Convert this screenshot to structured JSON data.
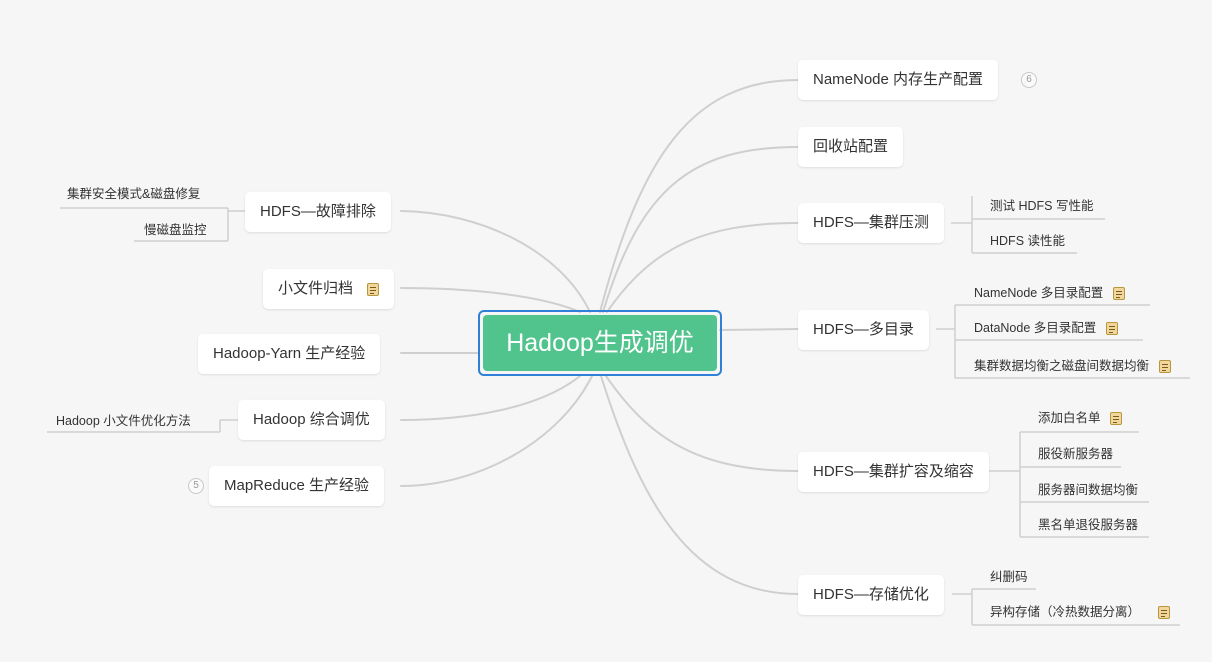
{
  "central": "Hadoop生成调优",
  "right": {
    "namenode_memory": "NameNode 内存生产配置",
    "namenode_memory_badge": "6",
    "recycle": "回收站配置",
    "benchmark": "HDFS—集群压测",
    "benchmark_write": "测试 HDFS 写性能",
    "benchmark_read": "HDFS 读性能",
    "multi_dir": "HDFS—多目录",
    "multi_dir_namenode": "NameNode 多目录配置",
    "multi_dir_datanode": "DataNode 多目录配置",
    "multi_dir_balance": "集群数据均衡之磁盘间数据均衡",
    "scale": "HDFS—集群扩容及缩容",
    "scale_whitelist": "添加白名单",
    "scale_new_server": "服役新服务器",
    "scale_balance": "服务器间数据均衡",
    "scale_blacklist": "黑名单退役服务器",
    "storage": "HDFS—存储优化",
    "storage_ec": "纠删码",
    "storage_hetero": "异构存储（冷热数据分离）"
  },
  "left": {
    "fault": "HDFS—故障排除",
    "fault_safemode": "集群安全模式&磁盘修复",
    "fault_slowdisk": "慢磁盘监控",
    "small_file": "小文件归档",
    "yarn": "Hadoop-Yarn 生产经验",
    "tuning": "Hadoop 综合调优",
    "tuning_smallfile": "Hadoop 小文件优化方法",
    "mapreduce": "MapReduce 生产经验",
    "mapreduce_badge": "5"
  },
  "icons": {
    "note": "note-icon",
    "collapsed_count": "collapsed-count-badge"
  },
  "colors": {
    "central_fill": "#51c38c",
    "central_border": "#2f80d6",
    "connector": "#cfcfcf",
    "background": "#f6f6f6"
  }
}
